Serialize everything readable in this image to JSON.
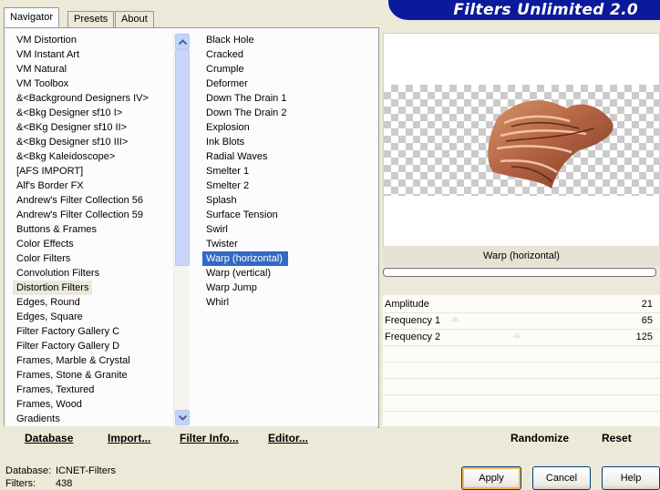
{
  "tabs": [
    {
      "label": "Navigator",
      "active": true
    },
    {
      "label": "Presets",
      "active": false
    },
    {
      "label": "About",
      "active": false
    }
  ],
  "banner": {
    "title": "Filters Unlimited 2.0",
    "color": "#0b1a9a"
  },
  "categories": {
    "items": [
      "VM Distortion",
      "VM Instant Art",
      "VM Natural",
      "VM Toolbox",
      "&<Background Designers IV>",
      "&<Bkg Designer sf10 I>",
      "&<BKg Designer sf10 II>",
      "&<Bkg Designer sf10 III>",
      "&<Bkg Kaleidoscope>",
      "[AFS IMPORT]",
      "Alf's Border FX",
      "Andrew's Filter Collection 56",
      "Andrew's Filter Collection 59",
      "Buttons & Frames",
      "Color Effects",
      "Color Filters",
      "Convolution Filters",
      "Distortion Filters",
      "Edges, Round",
      "Edges, Square",
      "Filter Factory Gallery C",
      "Filter Factory Gallery D",
      "Frames, Marble & Crystal",
      "Frames, Stone & Granite",
      "Frames, Textured",
      "Frames, Wood",
      "Gradients"
    ],
    "selected_index": 17
  },
  "filters": {
    "items": [
      "Black Hole",
      "Cracked",
      "Crumple",
      "Deformer",
      "Down The Drain 1",
      "Down The Drain 2",
      "Explosion",
      "Ink Blots",
      "Radial Waves",
      "Smelter 1",
      "Smelter 2",
      "Splash",
      "Surface Tension",
      "Swirl",
      "Twister",
      "Warp (horizontal)",
      "Warp (vertical)",
      "Warp Jump",
      "Whirl"
    ],
    "selected_index": 15,
    "selection_color": "#316ac5"
  },
  "toolbar": {
    "database": "Database",
    "import": "Import...",
    "filter_info": "Filter Info...",
    "editor": "Editor..."
  },
  "preview": {
    "filter_name": "Warp (horizontal)",
    "progress": 0
  },
  "params": [
    {
      "label": "Amplitude",
      "value": "21"
    },
    {
      "label": "Frequency 1",
      "value": "65"
    },
    {
      "label": "Frequency 2",
      "value": "125"
    }
  ],
  "right_toolbar": {
    "randomize": "Randomize",
    "reset": "Reset"
  },
  "status": {
    "database_label": "Database:",
    "database_value": "ICNET-Filters",
    "filters_label": "Filters:",
    "filters_value": "438"
  },
  "buttons": {
    "apply": "Apply",
    "cancel": "Cancel",
    "help": "Help"
  }
}
